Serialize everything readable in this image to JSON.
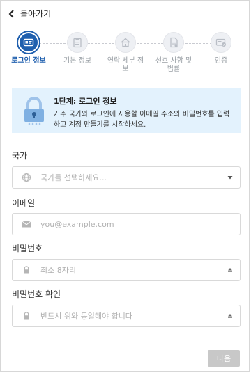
{
  "topbar": {
    "back_label": "돌아가기"
  },
  "stepper": {
    "steps": [
      {
        "label": "로그인 정보",
        "icon": "id-card-icon"
      },
      {
        "label": "기본 정보",
        "icon": "clipboard-icon"
      },
      {
        "label": "연락 세부 정\n보",
        "icon": "home-icon"
      },
      {
        "label": "선호 사항 및\n법률",
        "icon": "document-icon"
      },
      {
        "label": "인증",
        "icon": "verified-card-icon"
      }
    ],
    "active_index": 0
  },
  "info": {
    "title": "1단계: 로그인 정보",
    "description": "거주 국가와 로그인에 사용할 이메일 주소와 비밀번호를 입력하고 계정 만들기를 시작하세요."
  },
  "form": {
    "country": {
      "label": "국가",
      "placeholder": "국가를 선택하세요..."
    },
    "email": {
      "label": "이메일",
      "placeholder": "you@example.com"
    },
    "password": {
      "label": "비밀번호",
      "placeholder": "최소 8자리"
    },
    "password_confirm": {
      "label": "비밀번호 확인",
      "placeholder": "반드시 위와 동일해야 합니다"
    }
  },
  "actions": {
    "next_label": "다음"
  },
  "colors": {
    "accent": "#1f5fae",
    "info_bg": "#e3f2fd",
    "disabled_button": "#c8c8c8"
  }
}
